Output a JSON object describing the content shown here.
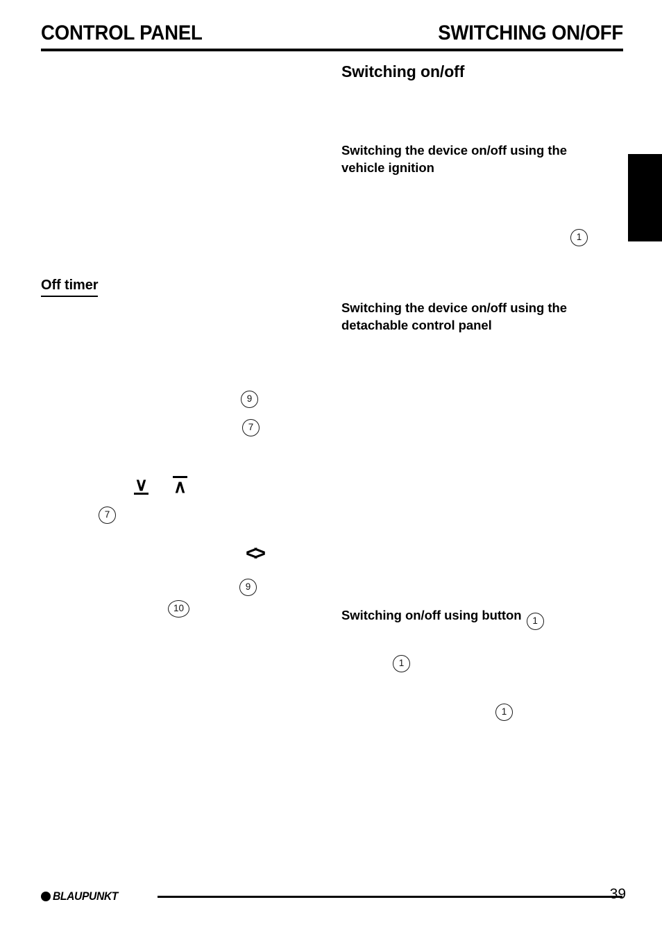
{
  "document": {
    "header": {
      "left_title": "CONTROL PANEL",
      "right_title": "SWITCHING ON/OFF"
    },
    "footer": {
      "brand": "BLAUPUNKT",
      "page_number": "39"
    }
  },
  "left_column": {
    "headings": [
      {
        "text": "Off timer",
        "style": "underlined"
      }
    ],
    "glyphs": [
      {
        "name": "down-arrow-underlined",
        "char": "∨"
      },
      {
        "name": "up-arrow-overlined",
        "char": "∧"
      },
      {
        "name": "left-right-chevrons",
        "char": "<>"
      }
    ],
    "callouts": [
      {
        "number": "9"
      },
      {
        "number": "7"
      },
      {
        "number": "7"
      },
      {
        "number": "9"
      },
      {
        "number": "10"
      }
    ]
  },
  "right_column": {
    "section_title": "Switching on/off",
    "subheadings": [
      "Switching the device on/off using the vehicle ignition",
      "Switching the device on/off using the detachable control panel"
    ],
    "button_heading": {
      "text": "Switching on/off using button",
      "callout": "1"
    },
    "callouts": [
      {
        "number": "1"
      },
      {
        "number": "1"
      },
      {
        "number": "1"
      }
    ]
  }
}
